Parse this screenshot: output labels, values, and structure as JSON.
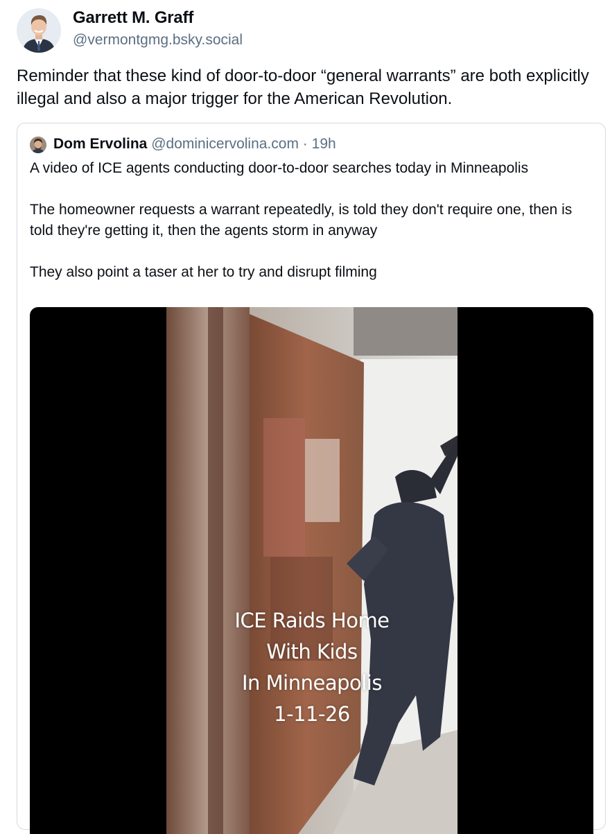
{
  "post": {
    "author": {
      "display_name": "Garrett M. Graff",
      "handle": "@vermontgmg.bsky.social"
    },
    "text": "Reminder that these kind of door-to-door “general warrants” are both explicitly illegal and also a major trigger for the American Revolution.",
    "quote": {
      "author_name": "Dom Ervolina",
      "author_handle": "@dominicervolina.com",
      "separator": "·",
      "time": "19h",
      "paragraphs": [
        "A video of ICE agents conducting door-to-door searches today in Minneapolis",
        "The homeowner requests a warrant repeatedly, is told they don't require one, then is told they're getting it, then the agents storm in anyway",
        "They also point a taser at her to try and disrupt filming"
      ],
      "video_caption_lines": [
        "ICE Raids Home",
        "With Kids",
        "In Minneapolis",
        "1-11-26"
      ]
    }
  },
  "colors": {
    "text": "#0b0f14",
    "secondary_text": "#5b6f82",
    "card_border": "#d4dbe2",
    "video_background": "#000000"
  },
  "icons": {
    "author_avatar": "profile-photo",
    "quote_avatar": "profile-photo"
  }
}
